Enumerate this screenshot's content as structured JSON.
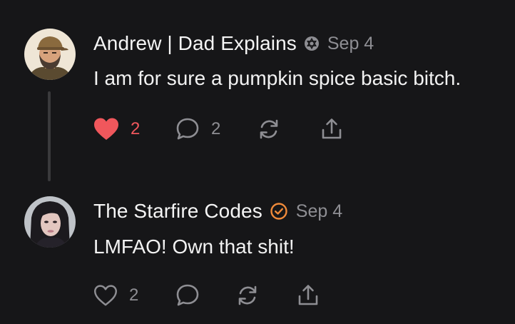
{
  "colors": {
    "background": "#161618",
    "text": "#f2f2f2",
    "muted": "#8e8e93",
    "like": "#f0575c",
    "verified": "#ef8a3a",
    "thread_line": "#3a3a3c"
  },
  "posts": [
    {
      "author": "Andrew | Dad Explains",
      "badge_icon": "star-of-david-badge-icon",
      "date": "Sep 4",
      "text": "I am for sure a pumpkin spice basic bitch.",
      "actions": {
        "like": {
          "icon": "heart-filled-icon",
          "count": "2",
          "liked": true
        },
        "comment": {
          "icon": "speech-bubble-icon",
          "count": "2"
        },
        "restack": {
          "icon": "repost-icon"
        },
        "share": {
          "icon": "share-upload-icon"
        }
      }
    },
    {
      "author": "The Starfire Codes",
      "badge_icon": "verified-check-icon",
      "date": "Sep 4",
      "text": "LMFAO! Own that shit!",
      "actions": {
        "like": {
          "icon": "heart-outline-icon",
          "count": "2",
          "liked": false
        },
        "comment": {
          "icon": "speech-bubble-icon",
          "count": ""
        },
        "restack": {
          "icon": "repost-icon"
        },
        "share": {
          "icon": "share-upload-icon"
        }
      }
    }
  ]
}
